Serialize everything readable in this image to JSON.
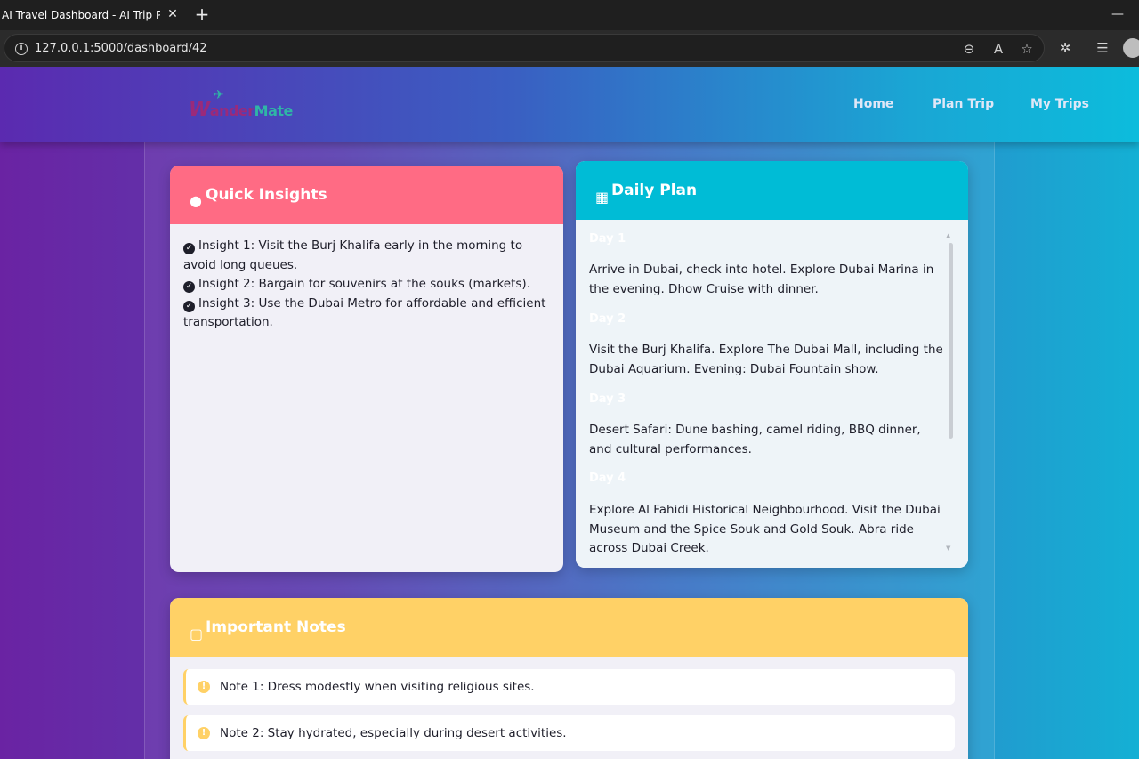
{
  "browser": {
    "tab_title": "AI Travel Dashboard - AI Trip Plan",
    "url": "127.0.0.1:5000/dashboard/42"
  },
  "nav": {
    "logo": {
      "part1": "W",
      "part2": "ander",
      "part3": "Mate"
    },
    "links": [
      "Home",
      "Plan Trip",
      "My Trips"
    ]
  },
  "insights": {
    "title": "Quick Insights",
    "items": [
      "Insight 1: Visit the Burj Khalifa early in the morning to avoid long queues.",
      "Insight 2: Bargain for souvenirs at the souks (markets).",
      "Insight 3: Use the Dubai Metro for affordable and efficient transportation."
    ]
  },
  "daily": {
    "title": "Daily Plan",
    "days": [
      {
        "label": "Day 1",
        "text": "Arrive in Dubai, check into hotel. Explore Dubai Marina in the evening. Dhow Cruise with dinner."
      },
      {
        "label": "Day 2",
        "text": "Visit the Burj Khalifa. Explore The Dubai Mall, including the Dubai Aquarium. Evening: Dubai Fountain show."
      },
      {
        "label": "Day 3",
        "text": "Desert Safari: Dune bashing, camel riding, BBQ dinner, and cultural performances."
      },
      {
        "label": "Day 4",
        "text": "Explore Al Fahidi Historical Neighbourhood. Visit the Dubai Museum and the Spice Souk and Gold Souk. Abra ride across Dubai Creek."
      }
    ]
  },
  "notes": {
    "title": "Important Notes",
    "items": [
      "Note 1: Dress modestly when visiting religious sites.",
      "Note 2: Stay hydrated, especially during desert activities."
    ]
  },
  "colors": {
    "insights_header": "#ff6b84",
    "daily_header": "#00bcd6",
    "notes_header": "#ffd166"
  }
}
